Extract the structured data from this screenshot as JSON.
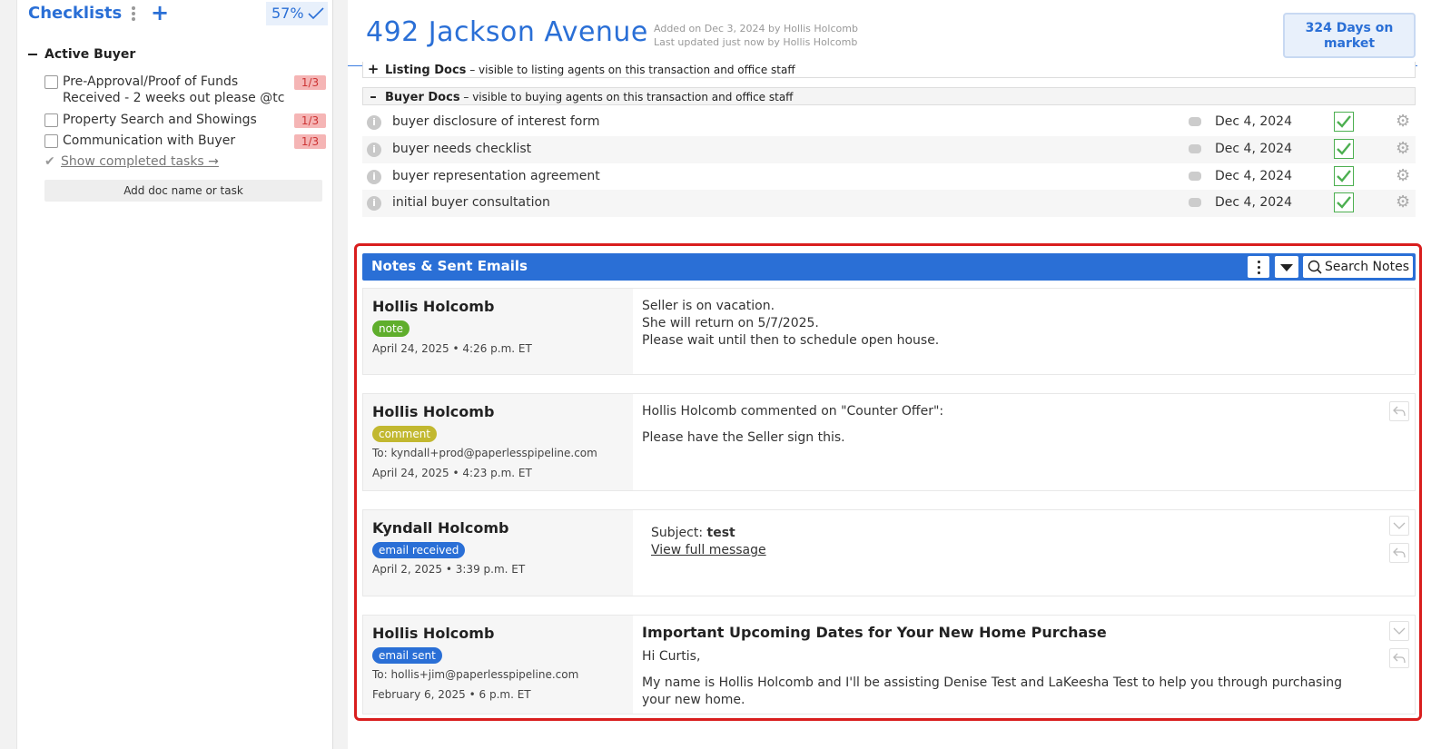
{
  "checklists": {
    "title": "Checklists",
    "progress": "57%",
    "group": "Active Buyer",
    "tasks": [
      {
        "label": "Pre-Approval/Proof of Funds Received - 2 weeks out please @tc",
        "count": "1/3"
      },
      {
        "label": "Property Search and Showings",
        "count": "1/3"
      },
      {
        "label": "Communication with Buyer",
        "count": "1/3"
      }
    ],
    "show_completed": "Show completed tasks →",
    "add_doc": "Add doc name or task"
  },
  "header": {
    "address": "492 Jackson Avenue",
    "added": "Added on Dec 3, 2024 by Hollis Holcomb",
    "updated": "Last updated just now by Hollis Holcomb",
    "days_on_market": "324 Days on market"
  },
  "sections": {
    "listing": {
      "name": "Listing Docs",
      "desc": "– visible to listing agents on this transaction and office staff"
    },
    "buyer": {
      "name": "Buyer Docs",
      "desc": "– visible to buying agents on this transaction and office staff"
    }
  },
  "docs": [
    {
      "name": "buyer disclosure of interest form",
      "date": "Dec 4, 2024"
    },
    {
      "name": "buyer needs checklist",
      "date": "Dec 4, 2024"
    },
    {
      "name": "buyer representation agreement",
      "date": "Dec 4, 2024"
    },
    {
      "name": "initial buyer consultation",
      "date": "Dec 4, 2024"
    }
  ],
  "notes_panel": {
    "title": "Notes & Sent Emails",
    "search_label": "Search Notes"
  },
  "notes": [
    {
      "author": "Hollis Holcomb",
      "tag": "note",
      "time": "April 24, 2025 • 4:26 p.m. ET",
      "lines": [
        "Seller is on vacation.",
        "She will return on 5/7/2025.",
        "Please wait until then to schedule open house."
      ]
    },
    {
      "author": "Hollis Holcomb",
      "tag": "comment",
      "to": "To: kyndall+prod@paperlesspipeline.com",
      "time": "April 24, 2025 • 4:23 p.m. ET",
      "line1": "Hollis Holcomb commented on \"Counter Offer\":",
      "line2": "Please have the Seller sign this."
    },
    {
      "author": "Kyndall Holcomb",
      "tag": "email received",
      "time": "April 2, 2025 • 3:39 p.m. ET",
      "subject_label": "Subject:",
      "subject": "test",
      "view_link": "View full message"
    },
    {
      "author": "Hollis Holcomb",
      "tag": "email sent",
      "to": "To: hollis+jim@paperlesspipeline.com",
      "time": "February 6, 2025 • 6 p.m. ET",
      "heading": "Important Upcoming Dates for Your New Home Purchase",
      "greeting": "Hi Curtis,",
      "paragraph": "My name is Hollis Holcomb and I'll be assisting Denise Test and LaKeesha Test to help you through purchasing your new home."
    }
  ]
}
